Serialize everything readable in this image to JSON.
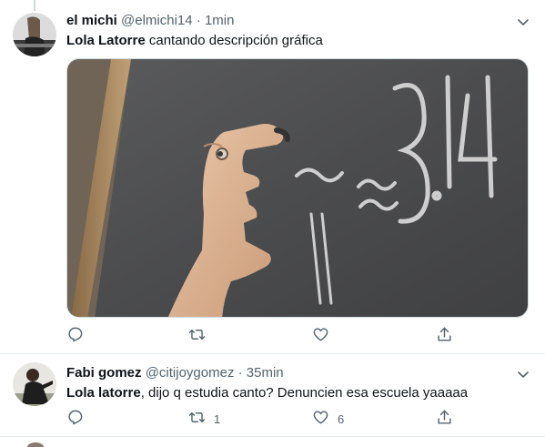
{
  "tweets": [
    {
      "name": "el michi",
      "handle": "@elmichi14",
      "dot": "·",
      "time": "1min",
      "mention": "Lola Latorre",
      "text": " cantando descripción gráfica",
      "media_icons": [
        "chalkboard-photo"
      ],
      "actions": {
        "reply": "",
        "retweet": "",
        "like": "",
        "share": ""
      }
    },
    {
      "name": "Fabi gomez",
      "handle": "@citijoygomez",
      "dot": "·",
      "time": "35min",
      "mention": "Lola latorre",
      "text": ", dijo q estudia canto? Denuncien esa escuela yaaaaa",
      "actions": {
        "reply": "",
        "retweet": "1",
        "like": "6",
        "share": ""
      }
    }
  ],
  "colors": {
    "secondary_text": "#536471",
    "divider": "#e6ecf0",
    "chalkboard": "#4d4e50"
  }
}
